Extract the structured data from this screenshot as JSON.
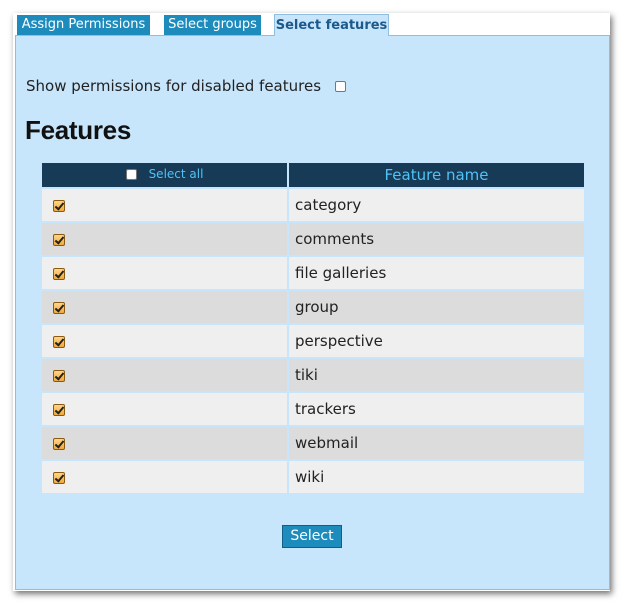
{
  "tabs": [
    {
      "label": "Assign Permissions"
    },
    {
      "label": "Select groups"
    },
    {
      "label": "Select features"
    }
  ],
  "show_disabled": {
    "label": "Show permissions for disabled features",
    "checked": false
  },
  "heading": "Features",
  "table": {
    "select_all_label": "Select all",
    "feature_name_header": "Feature name",
    "rows": [
      {
        "name": "category",
        "checked": true
      },
      {
        "name": "comments",
        "checked": true
      },
      {
        "name": "file galleries",
        "checked": true
      },
      {
        "name": "group",
        "checked": true
      },
      {
        "name": "perspective",
        "checked": true
      },
      {
        "name": "tiki",
        "checked": true
      },
      {
        "name": "trackers",
        "checked": true
      },
      {
        "name": "webmail",
        "checked": true
      },
      {
        "name": "wiki",
        "checked": true
      }
    ]
  },
  "submit_label": "Select",
  "colors": {
    "tab": "#1e8bbd",
    "panel": "#c7e5fb",
    "header": "#173a56",
    "header_text": "#4fc3f7"
  }
}
